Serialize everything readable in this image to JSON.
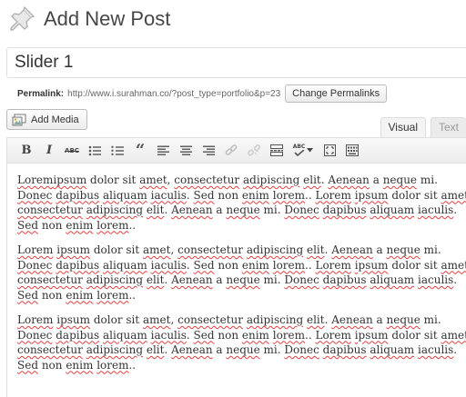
{
  "header": {
    "title": "Add New Post"
  },
  "post": {
    "title_value": "Slider 1"
  },
  "permalink": {
    "label": "Permalink:",
    "url": "http://www.i.surahman.co/?post_type=portfolio&p=23",
    "button_label": "Change Permalinks"
  },
  "media": {
    "button_label": "Add Media"
  },
  "tabs": {
    "visual": "Visual",
    "text": "Text"
  },
  "toolbar": {
    "bold": "B",
    "italic": "I",
    "strikethrough": "ABC",
    "blockquote": "“",
    "spellcheck": "ABC"
  },
  "content": {
    "paragraphs": [
      [
        [
          "Lorem",
          "ipsum",
          " dolor sit ",
          "amet",
          ", ",
          "consectetur",
          " ",
          "adipiscing",
          " ",
          "elit",
          ". ",
          "Aenean",
          " a ",
          "neque",
          " mi."
        ],
        [
          "Donec",
          " ",
          "dapibus",
          " ",
          "aliquam",
          " ",
          "iaculis",
          ". ",
          "Sed",
          " non ",
          "enim",
          " ",
          "lorem",
          ".. ",
          "Lorem",
          " ",
          "ipsum",
          " dolor sit ",
          "amet",
          ","
        ],
        [
          "consectetur",
          " ",
          "adipiscing",
          " ",
          "elit",
          ". ",
          "Aenean",
          " a ",
          "neque",
          " mi. ",
          "Donec",
          " ",
          "dapibus",
          " ",
          "aliquam",
          " ",
          "iaculis",
          "."
        ],
        [
          "Sed",
          " non ",
          "enim",
          " ",
          "lorem",
          ".."
        ]
      ],
      [
        [
          "Lorem",
          " ",
          "ipsum",
          " dolor sit ",
          "amet",
          ", ",
          "consectetur",
          " ",
          "adipiscing",
          " ",
          "elit",
          ". ",
          "Aenean",
          " a ",
          "neque",
          " mi."
        ],
        [
          "Donec",
          " ",
          "dapibus",
          " ",
          "aliquam",
          " ",
          "iaculis",
          ". ",
          "Sed",
          " non ",
          "enim",
          " ",
          "lorem",
          ".. ",
          "Lorem",
          " ",
          "ipsum",
          " dolor sit ",
          "amet",
          ","
        ],
        [
          "consectetur",
          " ",
          "adipiscing",
          " ",
          "elit",
          ". ",
          "Aenean",
          " a ",
          "neque",
          " mi. ",
          "Donec",
          " ",
          "dapibus",
          " ",
          "aliquam",
          " ",
          "iaculis",
          "."
        ],
        [
          "Sed",
          " non ",
          "enim",
          " ",
          "lorem",
          ".."
        ]
      ],
      [
        [
          "Lorem",
          " ",
          "ipsum",
          " dolor sit ",
          "amet",
          ", ",
          "consectetur",
          " ",
          "adipiscing",
          " ",
          "elit",
          ". ",
          "Aenean",
          " a ",
          "neque",
          " mi."
        ],
        [
          "Donec",
          " ",
          "dapibus",
          " ",
          "aliquam",
          " ",
          "iaculis",
          ". ",
          "Sed",
          " non ",
          "enim",
          " ",
          "lorem",
          ".. ",
          "Lorem",
          " ",
          "ipsum",
          " dolor sit ",
          "amet",
          ","
        ],
        [
          "consectetur",
          " ",
          "adipiscing",
          " ",
          "elit",
          ". ",
          "Aenean",
          " a ",
          "neque",
          " mi. ",
          "Donec",
          " ",
          "dapibus",
          " ",
          "aliquam",
          " ",
          "iaculis",
          "."
        ],
        [
          "Sed",
          " non ",
          "enim",
          " ",
          "lorem",
          ".."
        ]
      ]
    ],
    "misspelled": [
      "Lorem",
      "ipsum",
      "amet",
      "consectetur",
      "adipiscing",
      "elit",
      "Aenean",
      "neque",
      "Donec",
      "dapibus",
      "aliquam",
      "iaculis",
      "Sed",
      "enim",
      "lorem"
    ]
  },
  "colors": {
    "spellcheck_underline": "#e04040",
    "title_text": "#464646"
  }
}
